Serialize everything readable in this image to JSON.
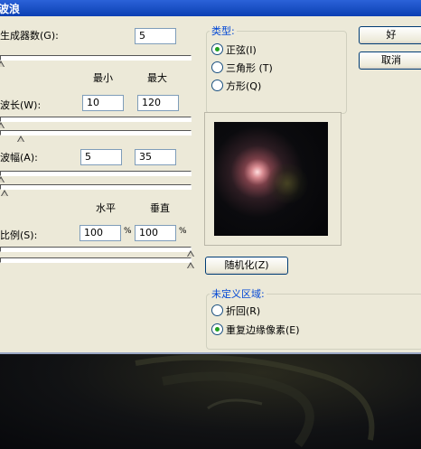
{
  "window": {
    "title": "波浪"
  },
  "params": {
    "generators": {
      "label": "生成器数(G):",
      "value": "5"
    },
    "col_min": "最小",
    "col_max": "最大",
    "wavelength": {
      "label": "波长(W):",
      "min": "10",
      "max": "120"
    },
    "amplitude": {
      "label": "波幅(A):",
      "min": "5",
      "max": "35"
    },
    "col_horizontal": "水平",
    "col_vertical": "垂直",
    "scale": {
      "label": "比例(S):",
      "h": "100",
      "v": "100",
      "unit": "%"
    }
  },
  "type_group": {
    "title": "类型:",
    "options": [
      {
        "label": "正弦(I)",
        "selected": true
      },
      {
        "label": "三角形 (T)",
        "selected": false
      },
      {
        "label": "方形(Q)",
        "selected": false
      }
    ]
  },
  "buttons": {
    "ok": "好",
    "cancel": "取消",
    "randomize": "随机化(Z)"
  },
  "undefined_group": {
    "title": "未定义区域:",
    "options": [
      {
        "label": "折回(R)",
        "selected": false
      },
      {
        "label": "重复边缘像素(E)",
        "selected": true
      }
    ]
  },
  "colors": {
    "accent": "#0046d5",
    "dialog_bg": "#ece9d8",
    "radio_on": "#21a121"
  }
}
